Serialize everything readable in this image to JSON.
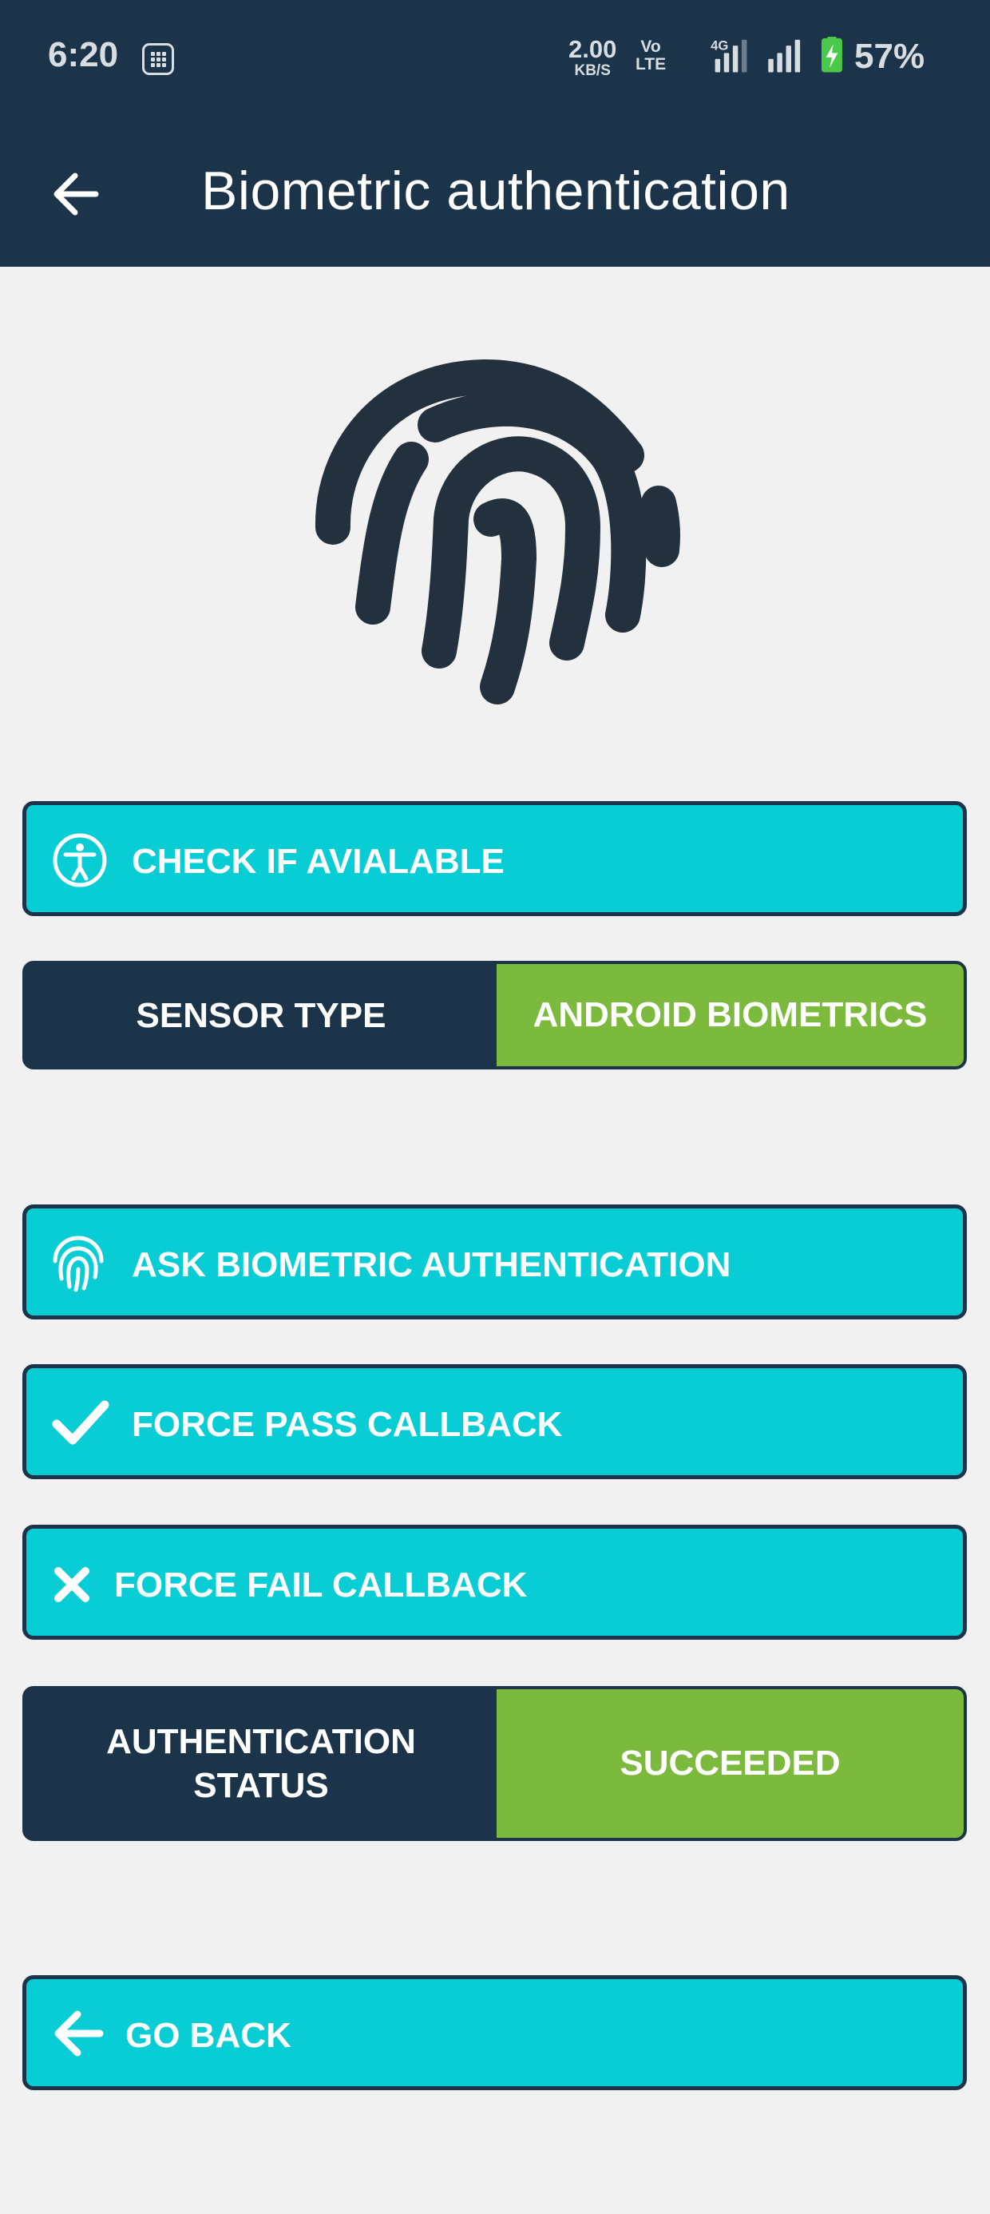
{
  "status_bar": {
    "time": "6:20",
    "net_speed_value": "2.00",
    "net_speed_unit": "KB/S",
    "volte_top": "Vo",
    "volte_bottom": "LTE",
    "network_type": "4G",
    "battery_percent": "57%"
  },
  "app_bar": {
    "title": "Biometric authentication",
    "back_icon": "arrow-left-icon"
  },
  "hero_icon": "fingerprint-icon",
  "buttons": {
    "check_available": {
      "label": "CHECK IF AVIALABLE",
      "icon": "accessibility-icon"
    },
    "ask_auth": {
      "label": "ASK BIOMETRIC AUTHENTICATION",
      "icon": "fingerprint-icon"
    },
    "force_pass": {
      "label": "FORCE PASS CALLBACK",
      "icon": "check-icon"
    },
    "force_fail": {
      "label": "FORCE FAIL CALLBACK",
      "icon": "close-icon"
    },
    "go_back": {
      "label": "GO BACK",
      "icon": "arrow-left-icon"
    }
  },
  "sensor": {
    "label": "SENSOR TYPE",
    "value": "ANDROID BIOMETRICS"
  },
  "auth_status": {
    "label_line1": "AUTHENTICATION",
    "label_line2": "STATUS",
    "value": "SUCCEEDED"
  },
  "colors": {
    "primary_dark": "#1b3449",
    "button_cyan": "#08cdd4",
    "success_green": "#7cba3e",
    "background": "#f1f1f1"
  }
}
